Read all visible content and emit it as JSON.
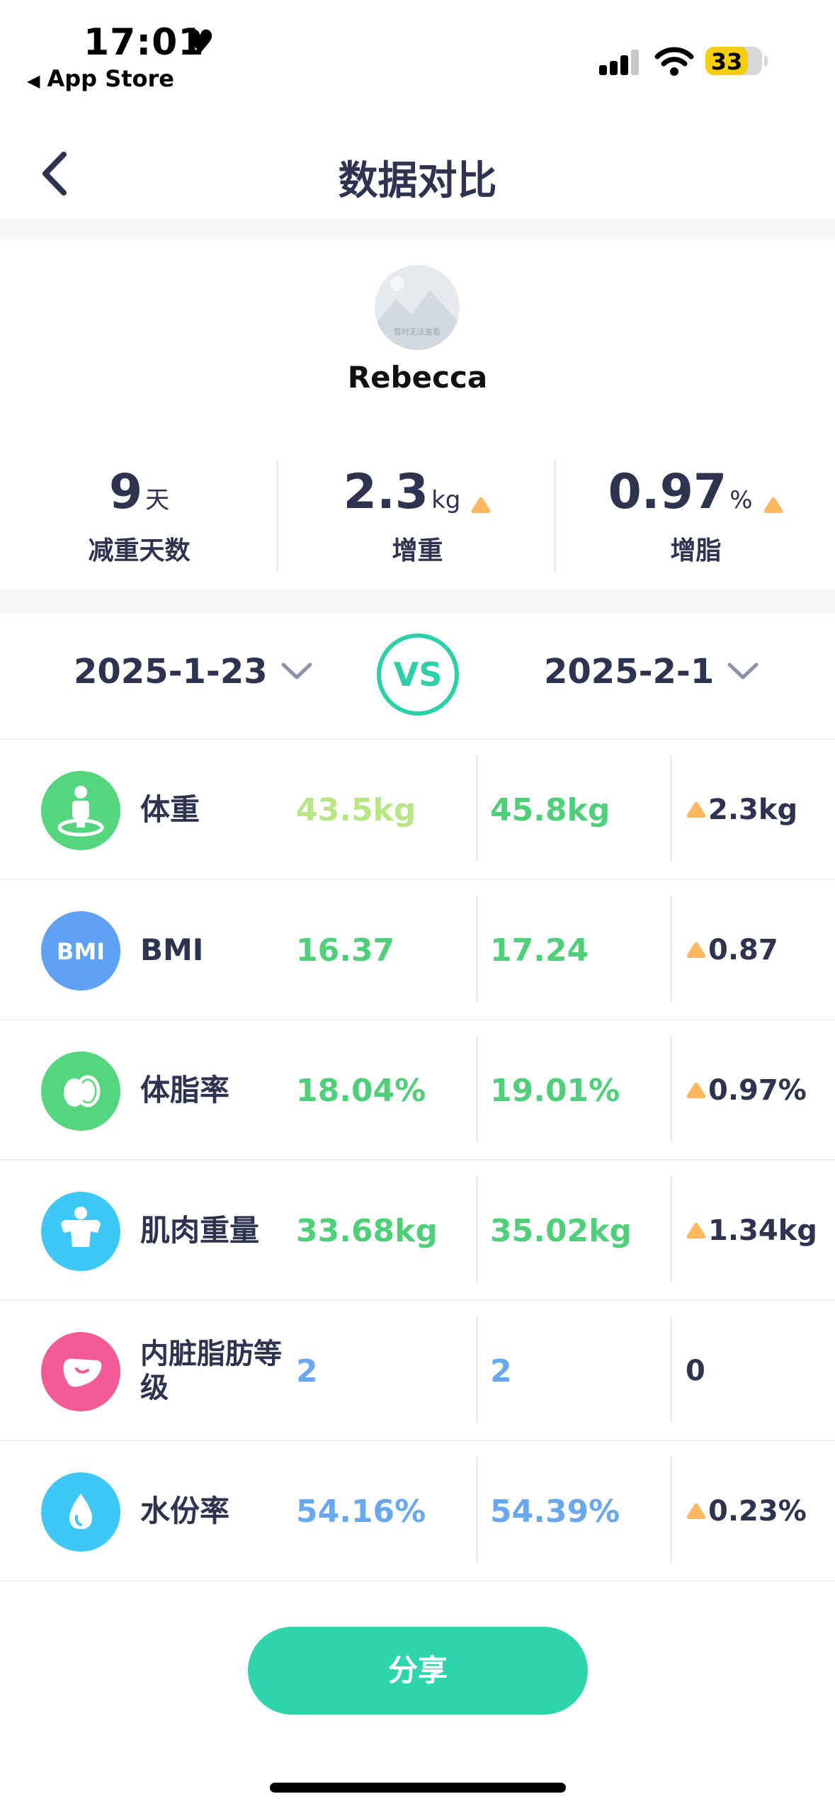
{
  "status_bar": {
    "time": "17:01",
    "back_app": "App Store",
    "battery": "33",
    "icons": [
      "heart-icon",
      "signal-icon",
      "wifi-icon",
      "battery-icon"
    ]
  },
  "nav": {
    "title": "数据对比",
    "back_icon": "chevron-left-icon"
  },
  "profile": {
    "avatar_caption": "暂时无法查看",
    "name": "Rebecca"
  },
  "summary": [
    {
      "value": "9",
      "unit": "天",
      "label": "减重天数",
      "trend": ""
    },
    {
      "value": "2.3",
      "unit": "kg",
      "label": "增重",
      "trend": "up"
    },
    {
      "value": "0.97",
      "unit": "%",
      "label": "增脂",
      "trend": "up"
    }
  ],
  "compare": {
    "date_left": "2025-1-23",
    "vs": "VS",
    "date_right": "2025-2-1"
  },
  "rows": [
    {
      "icon": "person-scale-icon",
      "icon_color": "#55d67e",
      "label": "体重",
      "v1": "43.5kg",
      "v2": "45.8kg",
      "diff": "2.3kg",
      "up": true
    },
    {
      "icon": "bmi-icon",
      "icon_color": "#5fa2f5",
      "label": "BMI",
      "v1": "16.37",
      "v2": "17.24",
      "diff": "0.87",
      "up": true
    },
    {
      "icon": "fat-icon",
      "icon_color": "#55d67e",
      "label": "体脂率",
      "v1": "18.04%",
      "v2": "19.01%",
      "diff": "0.97%",
      "up": true
    },
    {
      "icon": "muscle-icon",
      "icon_color": "#3ec8f5",
      "label": "肌肉重量",
      "v1": "33.68kg",
      "v2": "35.02kg",
      "diff": "1.34kg",
      "up": true
    },
    {
      "icon": "organ-icon",
      "icon_color": "#f25b95",
      "label": "内脏脂肪等级",
      "v1": "2",
      "v2": "2",
      "diff": "0",
      "up": false
    },
    {
      "icon": "water-drop-icon",
      "icon_color": "#3ec8f5",
      "label": "水份率",
      "v1": "54.16%",
      "v2": "54.39%",
      "diff": "0.23%",
      "up": true
    }
  ],
  "share_button": "分享",
  "colors": {
    "accent": "#2dd4ac",
    "value_green": "#50cf7a",
    "value_blue": "#6aa8ee",
    "trend_up": "#fbb860"
  }
}
